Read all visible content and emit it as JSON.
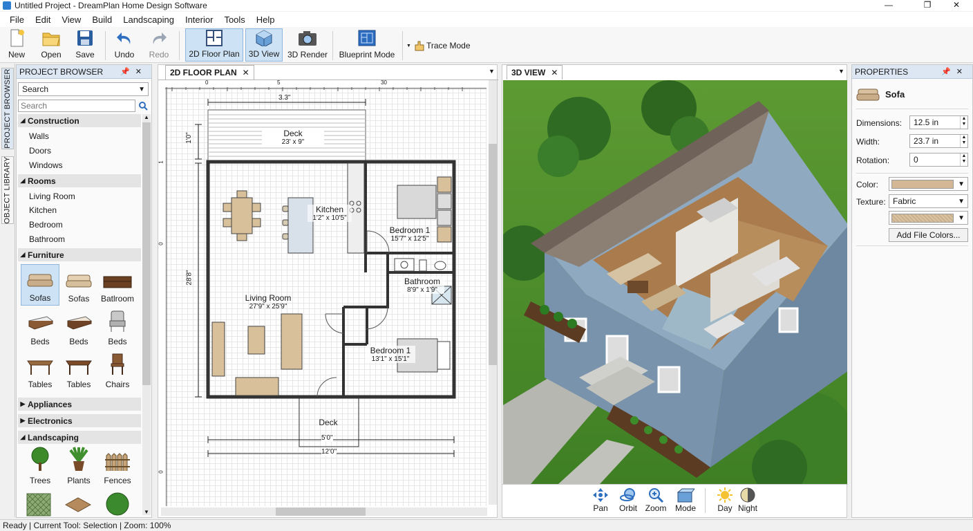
{
  "window": {
    "title": "Untitled Project - DreamPlan Home Design Software",
    "controls": {
      "minimize": "—",
      "maximize": "❐",
      "close": "✕"
    }
  },
  "menu": [
    "File",
    "Edit",
    "View",
    "Build",
    "Landscaping",
    "Interior",
    "Tools",
    "Help"
  ],
  "toolbar": {
    "new": "New",
    "open": "Open",
    "save": "Save",
    "undo": "Undo",
    "redo": "Redo",
    "floor2d": "2D Floor Plan",
    "view3d": "3D View",
    "render3d": "3D Render",
    "blueprint": "Blueprint Mode",
    "trace": "Trace Mode"
  },
  "side_tabs": {
    "browser": "PROJECT BROWSER",
    "library": "OBJECT LIBRARY"
  },
  "browser": {
    "header": "PROJECT BROWSER",
    "search_dropdown": "Search",
    "search_placeholder": "Search",
    "groups": {
      "construction": {
        "label": "Construction",
        "items": [
          "Walls",
          "Doors",
          "Windows"
        ]
      },
      "rooms": {
        "label": "Rooms",
        "items": [
          "Living Room",
          "Kitchen",
          "Bedroom",
          "Bathroom"
        ]
      },
      "furniture": {
        "label": "Furniture",
        "items": [
          "Sofas",
          "Sofas",
          "Batlroom",
          "Beds",
          "Beds",
          "Beds",
          "Tables",
          "Tables",
          "Chairs"
        ]
      },
      "appliances": {
        "label": "Appliances"
      },
      "electronics": {
        "label": "Electronics"
      },
      "landscaping": {
        "label": "Landscaping",
        "items": [
          "Trees",
          "Plants",
          "Fences"
        ]
      }
    }
  },
  "plan": {
    "tab": "2D FLOOR PLAN",
    "ruler": [
      "0",
      "5",
      "30"
    ],
    "vruler": [
      "1",
      "0",
      "0"
    ],
    "deck_top": {
      "name": "Deck",
      "size": "23' x 9\""
    },
    "kitchen": {
      "name": "Kitchen",
      "size": "1'2\" x 10'5\""
    },
    "bedroom_a": {
      "name": "Bedroom 1",
      "size": "15'7\" x 12'5\""
    },
    "bathroom": {
      "name": "Bathroom",
      "size": "8'9\" x 1'9\""
    },
    "living": {
      "name": "Living Room",
      "size": "27'9\" x 25'9\""
    },
    "bedroom_b": {
      "name": "Bedroom 1",
      "size": "13'1\" x 15'1\""
    },
    "deck_bottom": {
      "name": "Deck"
    },
    "dims": {
      "top": "3.3\"",
      "left_top": "1'0\"",
      "left_main": "28'8\"",
      "bottom_a": "5'0\"",
      "bottom_b": "12'0\""
    }
  },
  "view3d": {
    "tab": "3D VIEW",
    "nav": [
      "Pan",
      "Orbit",
      "Zoom",
      "Mode",
      "Day",
      "Night"
    ]
  },
  "properties": {
    "header": "PROPERTIES",
    "object": "Sofa",
    "dimensions_label": "Dimensions:",
    "dimensions": "12.5 in",
    "width_label": "Width:",
    "width": "23.7 in",
    "rotation_label": "Rotation:",
    "rotation": "0",
    "color_label": "Color:",
    "color": "#d4b896",
    "texture_label": "Texture:",
    "texture": "Fabric",
    "add_button": "Add File Colors..."
  },
  "status": "Ready | Current Tool: Selection | Zoom: 100%"
}
